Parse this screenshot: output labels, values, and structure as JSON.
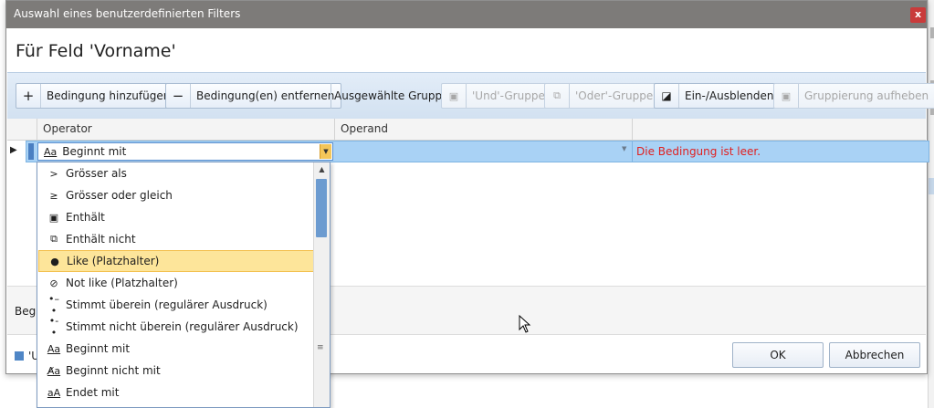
{
  "window": {
    "title": "Auswahl eines benutzerdefinierten Filters",
    "close_label": "x"
  },
  "heading": "Für Feld 'Vorname'",
  "toolbar": {
    "add_condition": "Bedingung hinzufügen",
    "remove_condition": "Bedingung(en) entfernen",
    "group_label": "Ausgewählte Gruppe:",
    "and_group": "'Und'-Gruppe",
    "or_group": "'Oder'-Gruppe",
    "toggle": "Ein-/Ausblenden",
    "ungroup": "Gruppierung aufheben"
  },
  "grid": {
    "columns": [
      "Operator",
      "Operand",
      ""
    ],
    "row": {
      "operator": "Beginnt mit",
      "operator_icon": "Aa",
      "operand": "",
      "error": "Die Bedingung ist leer."
    }
  },
  "summary": {
    "text": "Begin"
  },
  "legend": {
    "text": "'U"
  },
  "buttons": {
    "ok": "OK",
    "cancel": "Abbrechen"
  },
  "dropdown": {
    "selected_index": 4,
    "items": [
      {
        "icon": ">",
        "label": "Grösser als"
      },
      {
        "icon": "≥",
        "label": "Grösser oder gleich"
      },
      {
        "icon": "▣",
        "label": "Enthält"
      },
      {
        "icon": "⧉",
        "label": "Enthält nicht"
      },
      {
        "icon": "●",
        "label": "Like (Platzhalter)"
      },
      {
        "icon": "⊘",
        "label": "Not like (Platzhalter)"
      },
      {
        "icon": "•–•",
        "label": "Stimmt überein (regulärer Ausdruck)"
      },
      {
        "icon": "•-•",
        "label": "Stimmt nicht überein (regulärer Ausdruck)"
      },
      {
        "icon": "Aa",
        "label": "Beginnt mit"
      },
      {
        "icon": "A̸a",
        "label": "Beginnt nicht mit"
      },
      {
        "icon": "aA",
        "label": "Endet mit"
      }
    ]
  },
  "colors": {
    "titlebar": "#7d7b79",
    "selection_row": "#a9d2f5",
    "error_text": "#e02020",
    "highlight_item": "#fde59a"
  }
}
